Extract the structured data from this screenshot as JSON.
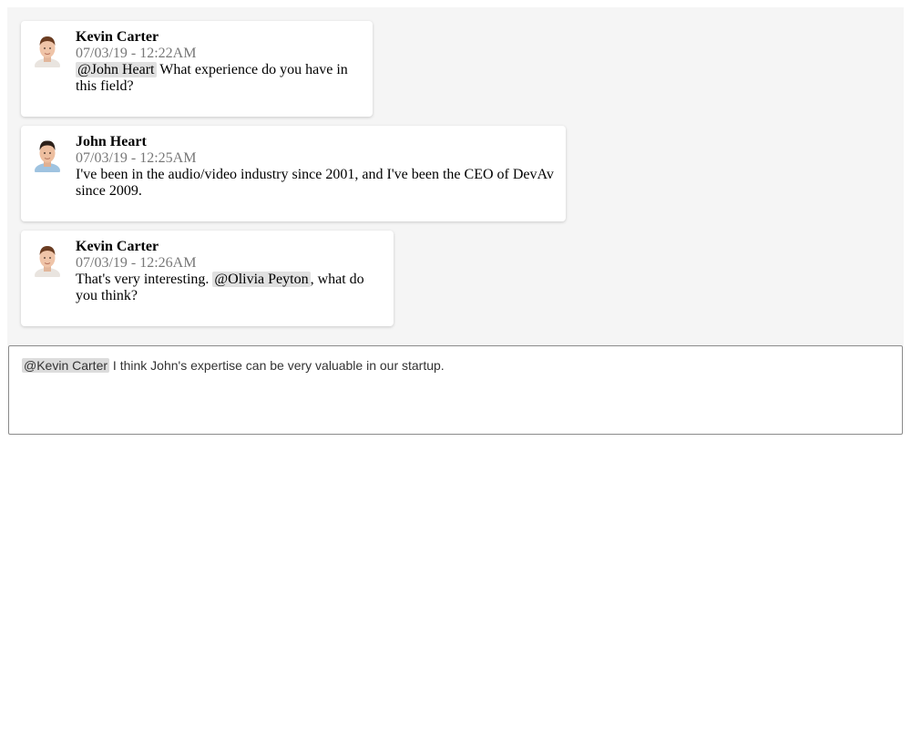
{
  "messages": [
    {
      "author": "Kevin Carter",
      "timestamp": "07/03/19 - 12:22AM",
      "mention": "@John Heart",
      "text_before": "",
      "text_after": " What experience do you have in this field?"
    },
    {
      "author": "John Heart",
      "timestamp": "07/03/19 - 12:25AM",
      "text": "I've been in the audio/video industry since 2001, and I've been the CEO of DevAv since 2009."
    },
    {
      "author": "Kevin Carter",
      "timestamp": "07/03/19 - 12:26AM",
      "text_before": "That's very interesting. ",
      "mention": "@Olivia Peyton",
      "text_after": ", what do you think?"
    }
  ],
  "reply": {
    "mention": "@Kevin Carter",
    "text": " I think John's expertise can be very valuable in our startup."
  },
  "colors": {
    "panel_bg": "#f5f5f5",
    "mention_bg": "#e0e0e0",
    "timestamp": "#777777"
  },
  "icons": {
    "avatar_kevin": "avatar-kevin-carter-icon",
    "avatar_john": "avatar-john-heart-icon"
  }
}
